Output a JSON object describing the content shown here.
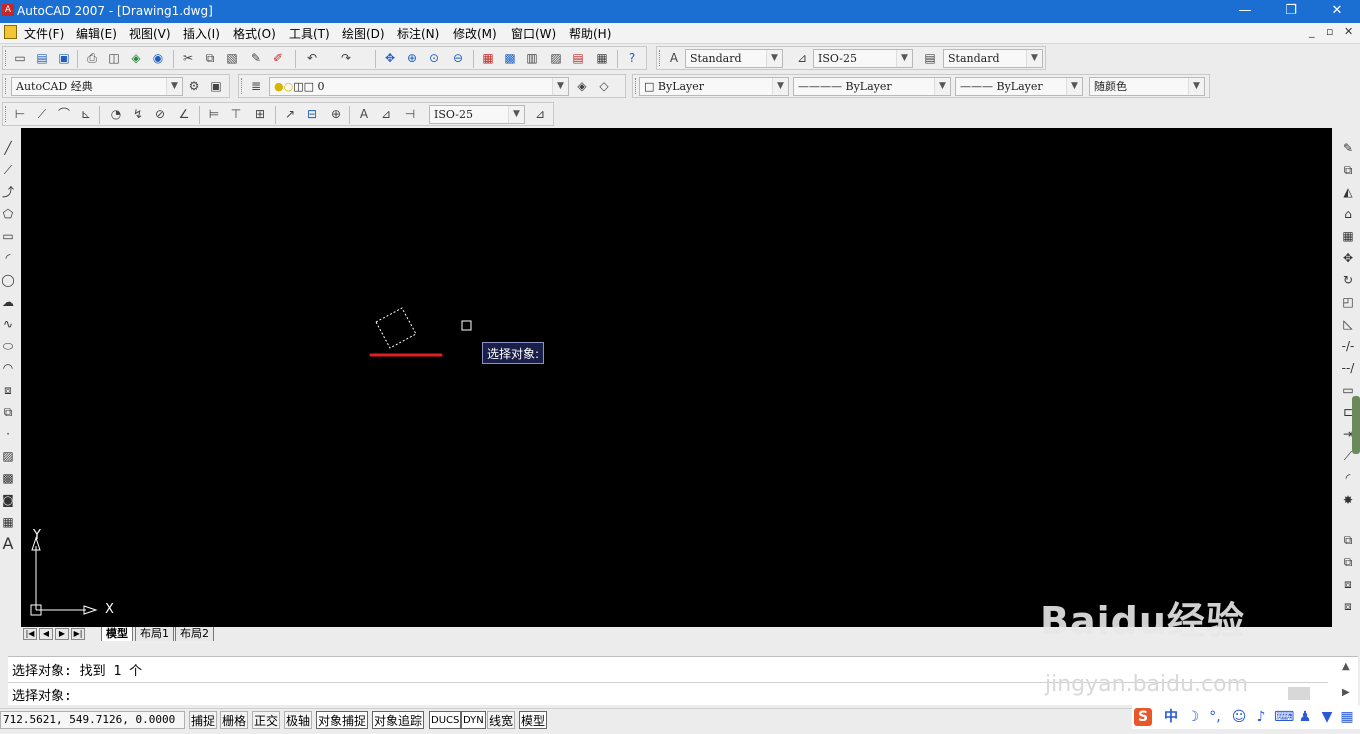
{
  "window": {
    "title": "AutoCAD 2007 - [Drawing1.dwg]",
    "controls": [
      "—",
      "❐",
      "✕"
    ]
  },
  "menu": {
    "items": [
      "文件(F)",
      "编辑(E)",
      "视图(V)",
      "插入(I)",
      "格式(O)",
      "工具(T)",
      "绘图(D)",
      "标注(N)",
      "修改(M)",
      "窗口(W)",
      "帮助(H)"
    ],
    "mdi": [
      "_",
      "▫",
      "✕"
    ]
  },
  "toolbar_standard": {
    "text_style": "Standard",
    "dim_style": "ISO-25",
    "table_style": "Standard"
  },
  "toolbar_layers": {
    "workspace": "AutoCAD 经典",
    "current_layer": "0",
    "color": "ByLayer",
    "linetype": "ByLayer",
    "lineweight": "ByLayer",
    "plot_style": "随颜色"
  },
  "toolbar_dim": {
    "dim_style": "ISO-25"
  },
  "canvas": {
    "ucs_x": "X",
    "ucs_y": "Y",
    "tooltip": "选择对象:",
    "background": "#000000",
    "highlight_color": "#e02020"
  },
  "layout_tabs": [
    "模型",
    "布局1",
    "布局2"
  ],
  "command": {
    "history": "选择对象: 找到 1 个",
    "prompt": "选择对象:"
  },
  "status": {
    "coords": "712.5621, 549.7126, 0.0000",
    "buttons": [
      "捕捉",
      "栅格",
      "正交",
      "极轴",
      "对象捕捉",
      "对象追踪",
      "DUCS",
      "DYN",
      "线宽",
      "模型"
    ]
  },
  "watermark": {
    "logo": "Baidu经验",
    "url": "jingyan.baidu.com"
  },
  "ime": {
    "label": "中"
  }
}
